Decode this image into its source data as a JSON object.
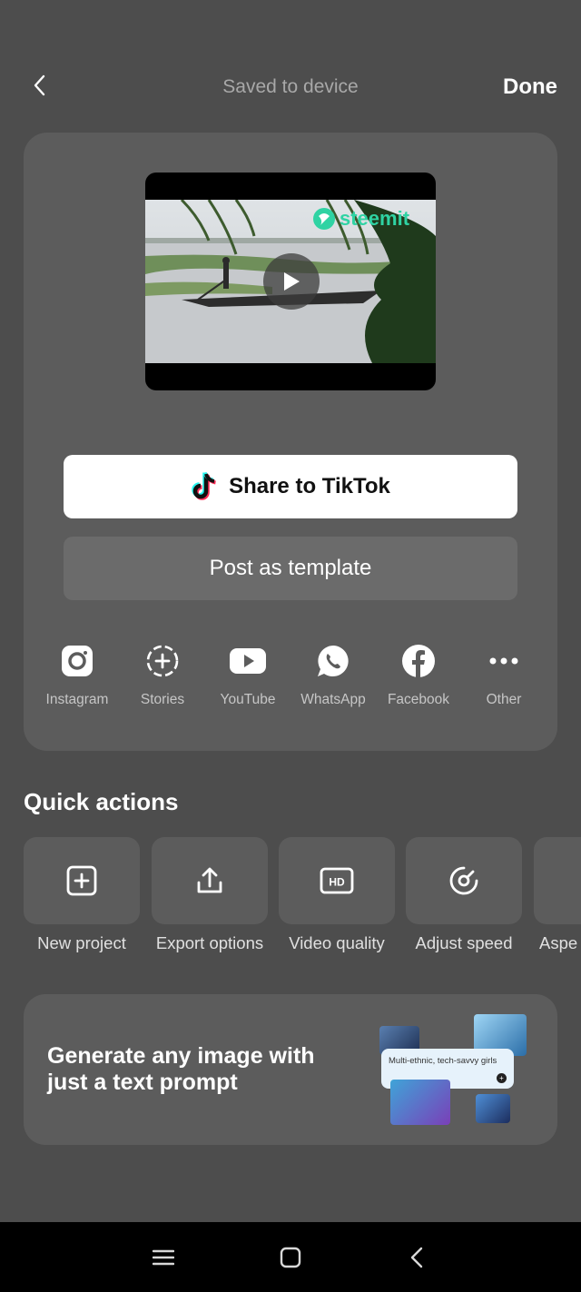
{
  "header": {
    "title": "Saved to device",
    "done_label": "Done"
  },
  "video": {
    "watermark": "steemit"
  },
  "buttons": {
    "share_tiktok": "Share to TikTok",
    "post_template": "Post as template"
  },
  "share_targets": [
    {
      "label": "Instagram",
      "icon": "instagram-icon"
    },
    {
      "label": "Stories",
      "icon": "stories-icon"
    },
    {
      "label": "YouTube",
      "icon": "youtube-icon"
    },
    {
      "label": "WhatsApp",
      "icon": "whatsapp-icon"
    },
    {
      "label": "Facebook",
      "icon": "facebook-icon"
    },
    {
      "label": "Other",
      "icon": "more-icon"
    }
  ],
  "quick_actions": {
    "title": "Quick actions",
    "items": [
      {
        "label": "New project",
        "icon": "add-square-icon"
      },
      {
        "label": "Export options",
        "icon": "export-icon"
      },
      {
        "label": "Video quality",
        "icon": "hd-icon"
      },
      {
        "label": "Adjust speed",
        "icon": "speed-icon"
      },
      {
        "label": "Aspe",
        "icon": "aspect-icon"
      }
    ]
  },
  "promo": {
    "text": "Generate any image with just a text prompt",
    "prompt": "Multi-ethnic, tech-savvy girls"
  },
  "colors": {
    "background": "#4d4d4d",
    "card": "#5c5c5c",
    "watermark": "#2fd3a3"
  }
}
